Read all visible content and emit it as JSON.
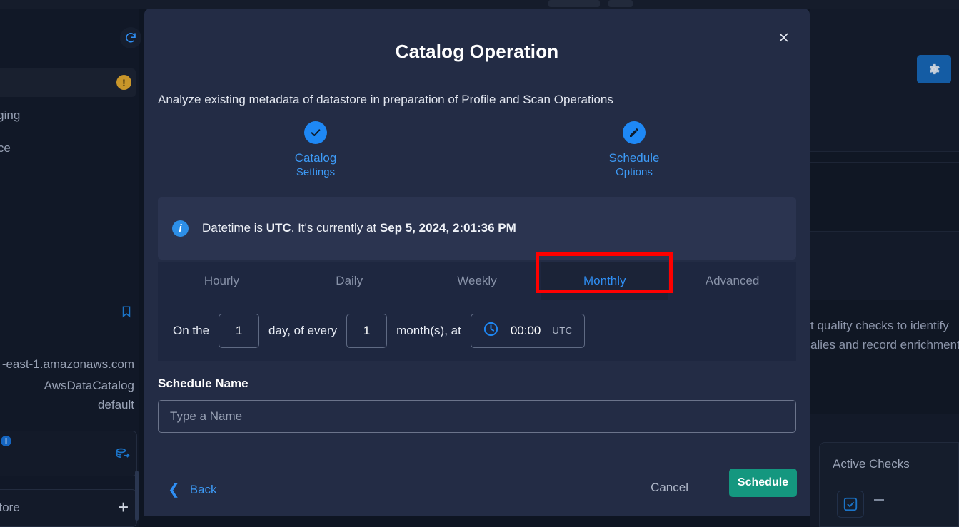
{
  "background": {
    "left": {
      "refresh_icon": "refresh-icon",
      "warning_badge": "!",
      "text_fragments": [
        "taging",
        "ance"
      ],
      "bookmark_icon": "bookmark-icon",
      "address_lines": [
        "-east-1.amazonaws.com",
        "AwsDataCatalog",
        "default"
      ],
      "info_dot": "i",
      "database_icon": "database-export-icon",
      "store_label": "store",
      "add_label": "+"
    },
    "right": {
      "gear_icon": "gear-icon",
      "description_lines": [
        "t quality checks to identify",
        "alies and record enrichment"
      ],
      "active_checks_title": "Active Checks",
      "active_checks_value": "—",
      "check_icon": "checkbox-checked-icon"
    }
  },
  "modal": {
    "title": "Catalog Operation",
    "subtitle": "Analyze existing metadata of datastore in preparation of Profile and Scan Operations",
    "close_icon": "close-icon",
    "stepper": [
      {
        "label": "Catalog",
        "sublabel": "Settings",
        "icon": "check-icon",
        "state": "completed"
      },
      {
        "label": "Schedule",
        "sublabel": "Options",
        "icon": "pencil-icon",
        "state": "active"
      }
    ],
    "info_banner": {
      "icon": "info-icon",
      "prefix": "Datetime is ",
      "timezone": "UTC",
      "middle": ". It's currently at ",
      "datetime": "Sep 5, 2024, 2:01:36 PM"
    },
    "tabs": [
      {
        "label": "Hourly",
        "active": false
      },
      {
        "label": "Daily",
        "active": false
      },
      {
        "label": "Weekly",
        "active": false
      },
      {
        "label": "Monthly",
        "active": true
      },
      {
        "label": "Advanced",
        "active": false
      }
    ],
    "schedule_row": {
      "prefix": "On the",
      "day_value": "1",
      "middle": "day, of every",
      "month_value": "1",
      "suffix": "month(s), at",
      "clock_icon": "clock-icon",
      "time_value": "00:00",
      "time_tz": "UTC"
    },
    "schedule_name": {
      "label": "Schedule Name",
      "value": "",
      "placeholder": "Type a Name"
    },
    "footer": {
      "back_label": "Back",
      "back_icon": "chevron-left-icon",
      "cancel_label": "Cancel",
      "submit_label": "Schedule"
    }
  },
  "annotation": {
    "color": "#fe0000",
    "target": "Monthly"
  }
}
